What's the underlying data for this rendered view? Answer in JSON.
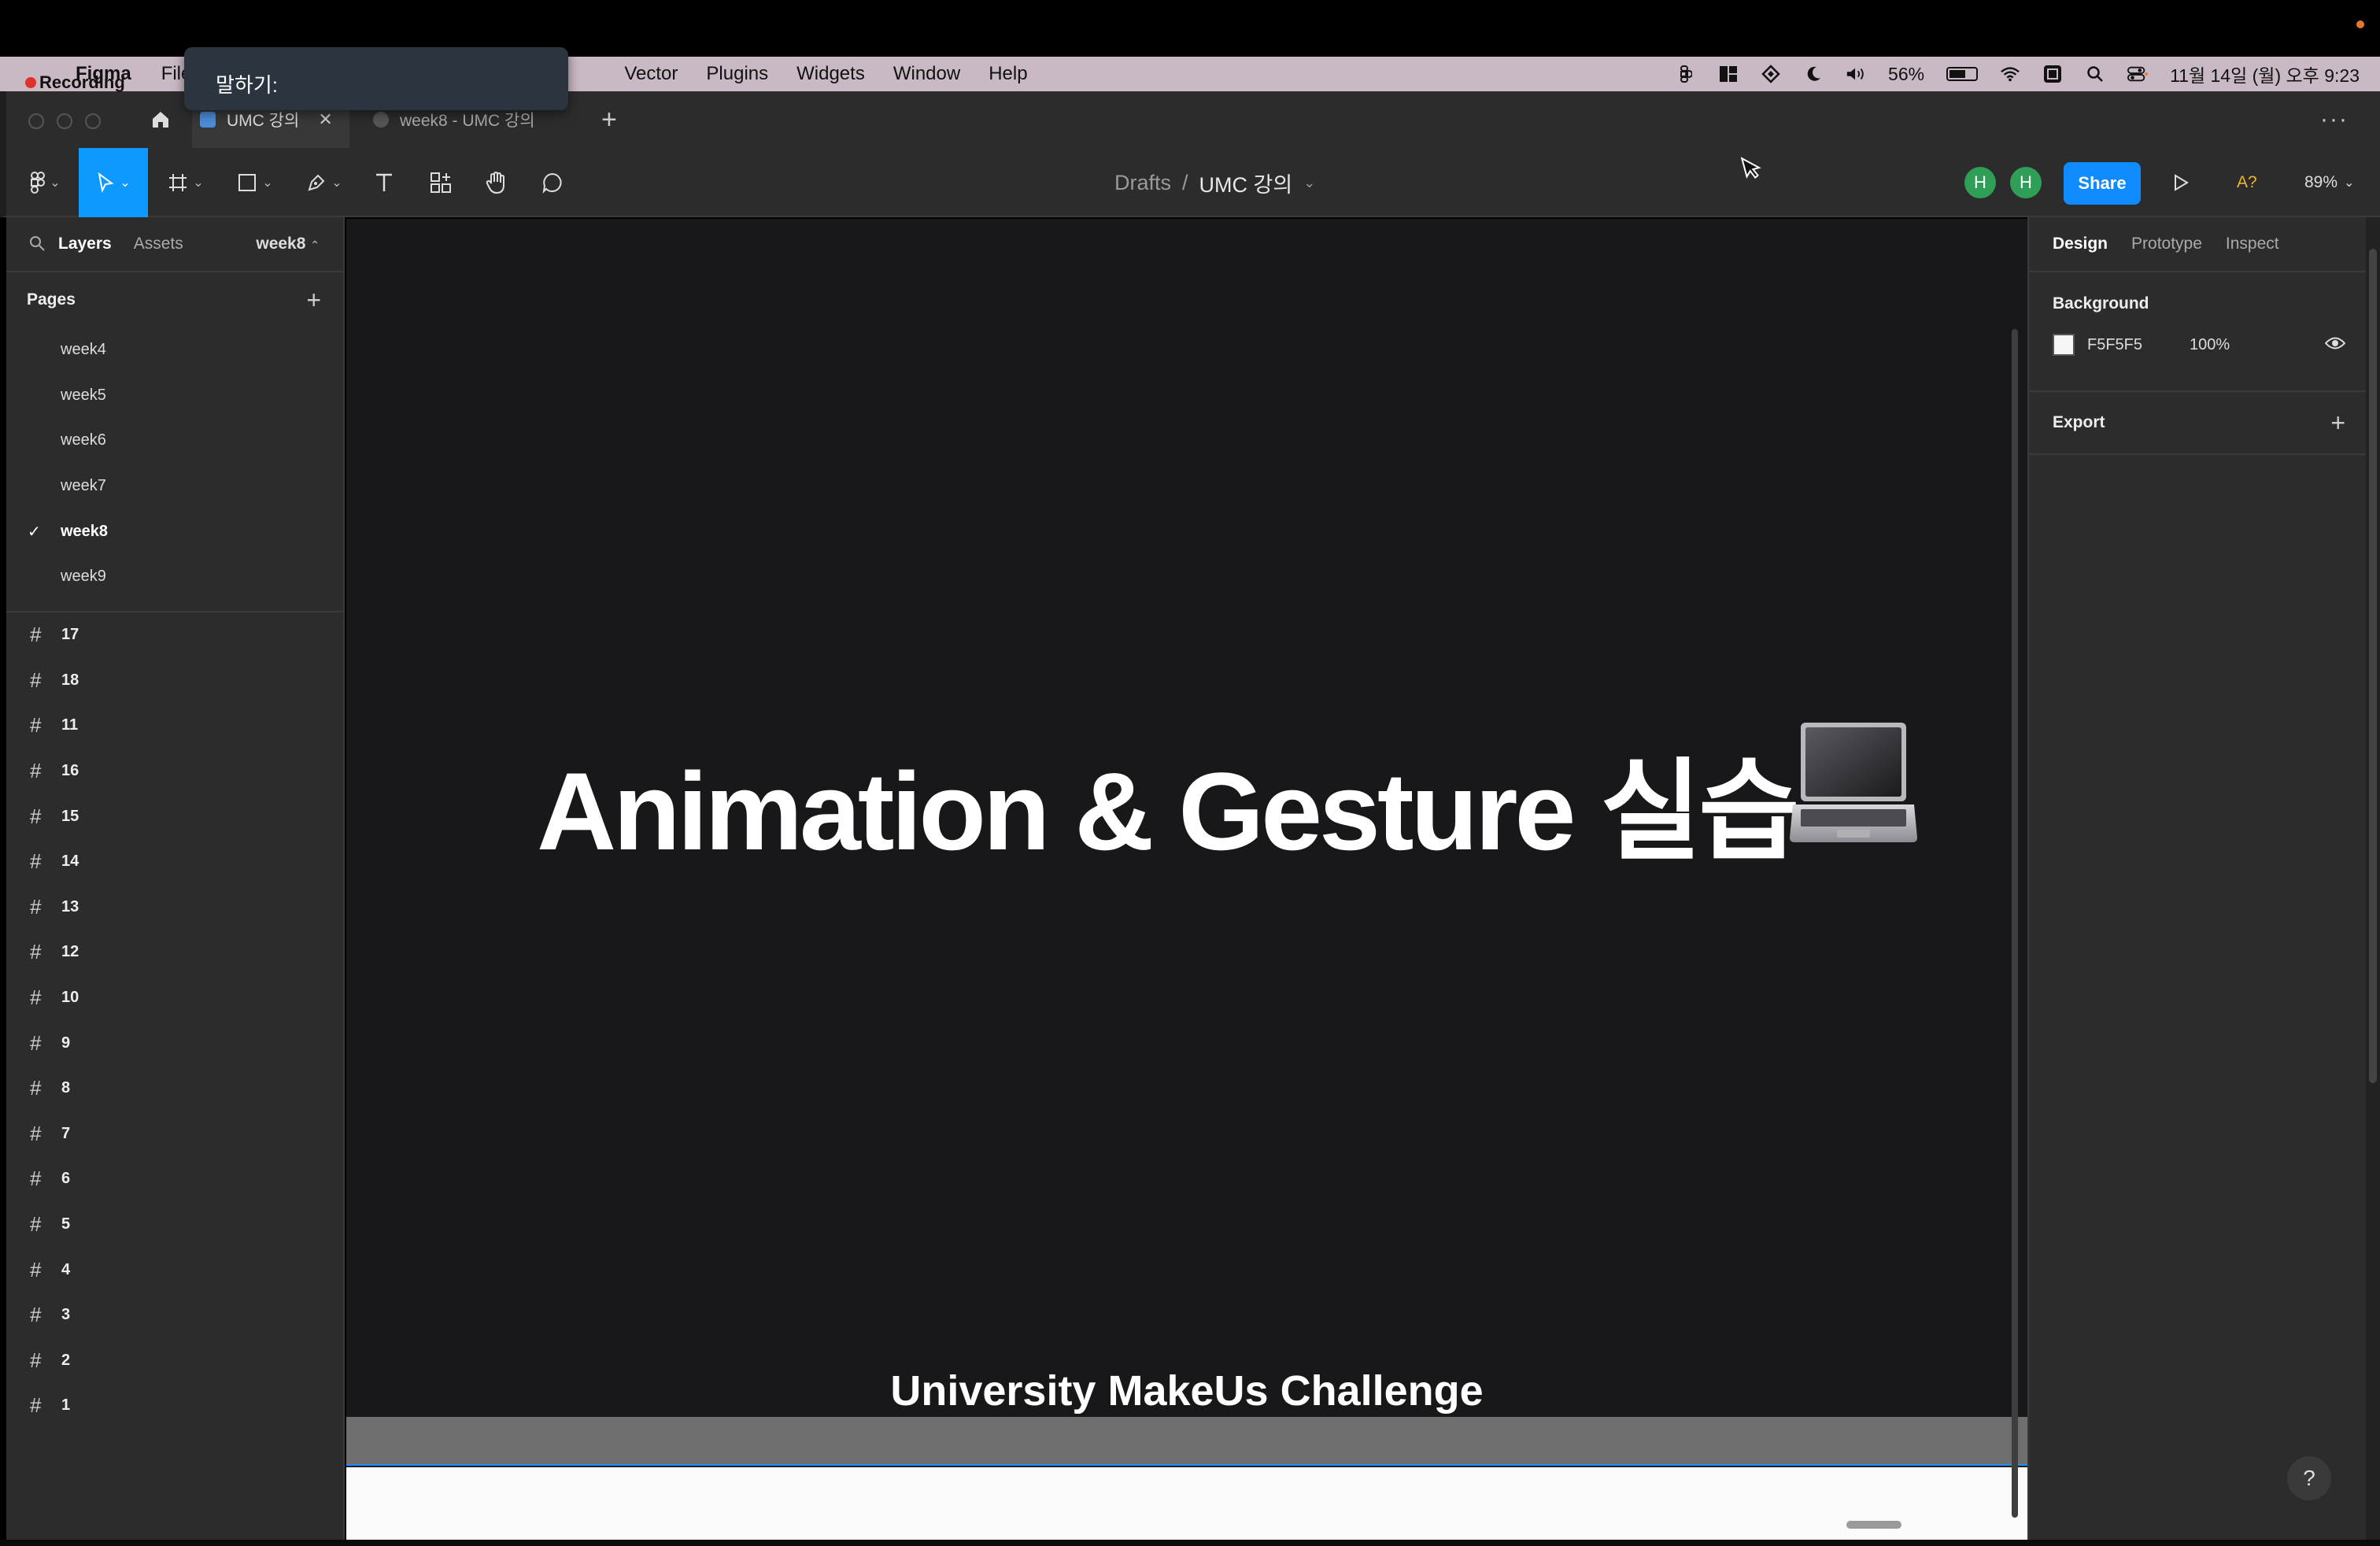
{
  "menubar": {
    "app_name": "Figma",
    "menus": [
      "File",
      "Vector",
      "Plugins",
      "Widgets",
      "Window",
      "Help"
    ],
    "recording_label": "Recording",
    "battery": "56%",
    "datetime": "11월 14일 (월) 오후 9:23"
  },
  "dictation": {
    "label": "말하기:"
  },
  "tabs": {
    "active": {
      "label": "UMC 강의"
    },
    "second": {
      "label": "week8 - UMC 강의"
    }
  },
  "toolbar": {
    "breadcrumb_root": "Drafts",
    "breadcrumb_sep": "/",
    "file_name": "UMC 강의",
    "avatars": [
      "H",
      "H"
    ],
    "share_label": "Share",
    "font_warning": "A?",
    "zoom": "89%"
  },
  "left_panel": {
    "tab_layers": "Layers",
    "tab_assets": "Assets",
    "current_page_selector": "week8",
    "pages_title": "Pages",
    "pages": [
      {
        "name": "week4",
        "current": false
      },
      {
        "name": "week5",
        "current": false
      },
      {
        "name": "week6",
        "current": false
      },
      {
        "name": "week7",
        "current": false
      },
      {
        "name": "week8",
        "current": true
      },
      {
        "name": "week9",
        "current": false
      }
    ],
    "layers": [
      "17",
      "18",
      "11",
      "16",
      "15",
      "14",
      "13",
      "12",
      "10",
      "9",
      "8",
      "7",
      "6",
      "5",
      "4",
      "3",
      "2",
      "1"
    ]
  },
  "canvas": {
    "headline": "Animation & Gesture 실습",
    "footer_title": "University MakeUs Challenge"
  },
  "right_panel": {
    "tab_design": "Design",
    "tab_prototype": "Prototype",
    "tab_inspect": "Inspect",
    "background_title": "Background",
    "background_hex": "F5F5F5",
    "background_opacity": "100%",
    "export_title": "Export"
  },
  "help_label": "?",
  "colors": {
    "accent": "#0d99ff",
    "share": "#0d8bff",
    "avatar": "#2f9e57",
    "canvas_frame": "#18181a",
    "panel": "#2c2c2c"
  }
}
